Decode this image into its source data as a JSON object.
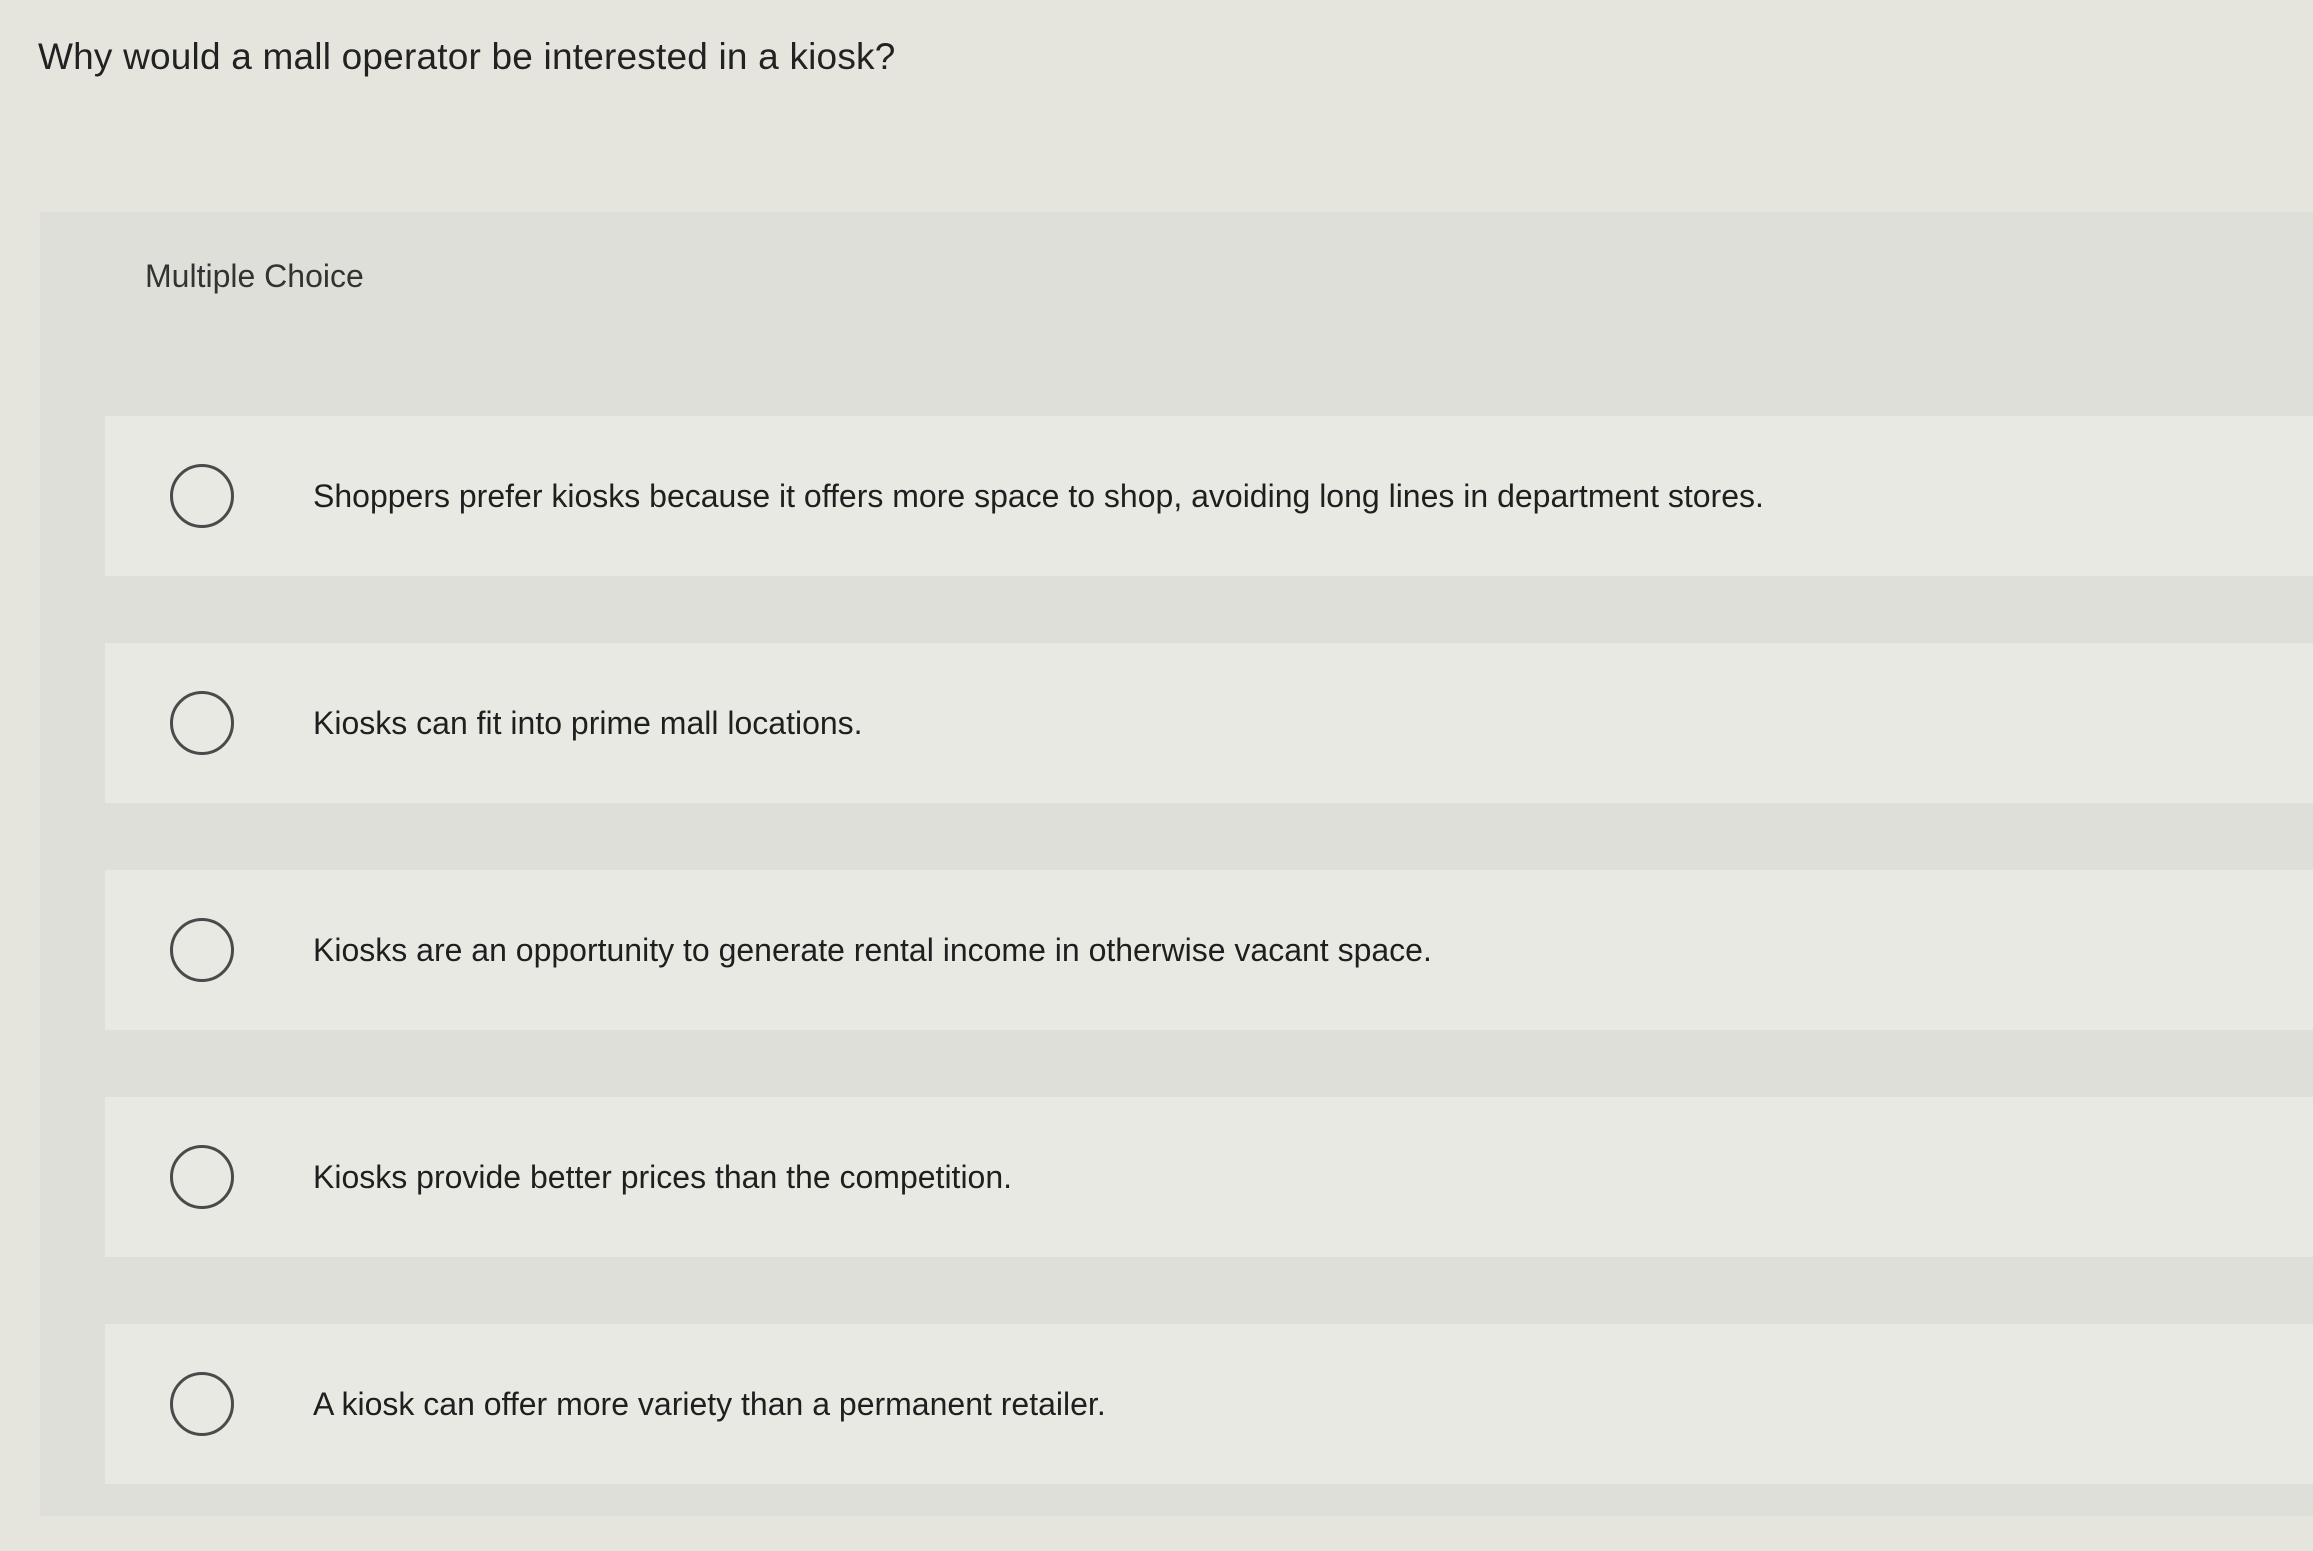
{
  "question": "Why would a mall operator be interested in a kiosk?",
  "type_label": "Multiple Choice",
  "options": [
    {
      "label": "Shoppers prefer kiosks because it offers more space to shop, avoiding long lines in department stores."
    },
    {
      "label": "Kiosks can fit into prime mall locations."
    },
    {
      "label": "Kiosks are an opportunity to generate rental income in otherwise vacant space."
    },
    {
      "label": "Kiosks provide better prices than the competition."
    },
    {
      "label": "A kiosk can offer more variety than a permanent retailer."
    }
  ]
}
